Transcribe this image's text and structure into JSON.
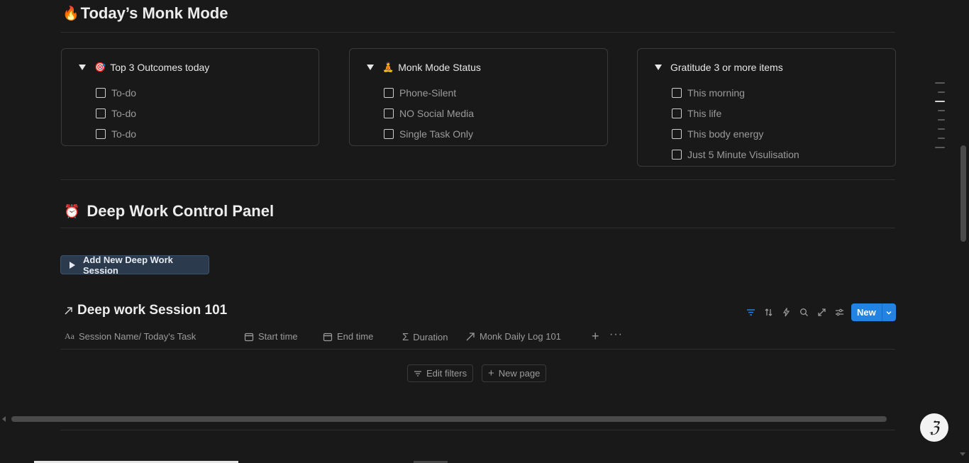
{
  "monk_mode": {
    "emoji": "🔥",
    "title": "Today’s Monk Mode"
  },
  "cards": [
    {
      "emoji": "🎯",
      "title": "Top 3 Outcomes today",
      "items": [
        "To-do",
        "To-do",
        "To-do"
      ]
    },
    {
      "emoji": "🧘",
      "title": "Monk Mode Status",
      "items": [
        "Phone-Silent",
        "NO Social Media",
        "Single Task Only"
      ]
    },
    {
      "emoji": "",
      "title": "Gratitude 3 or more items",
      "items": [
        "This morning",
        "This life",
        "This body energy",
        "Just 5 Minute Visulisation"
      ]
    }
  ],
  "deep_work": {
    "emoji": "⏰",
    "title": "Deep Work Control Panel",
    "add_button_label": "Add New Deep Work Session"
  },
  "database": {
    "title": "Deep work Session 101",
    "new_button_label": "New",
    "columns": [
      {
        "label": "Session Name/ Today's Task",
        "icon": "text-icon"
      },
      {
        "label": "Start time",
        "icon": "calendar-icon"
      },
      {
        "label": "End time",
        "icon": "calendar-icon"
      },
      {
        "label": "Duration",
        "icon": "sigma-icon"
      },
      {
        "label": "Monk Daily Log 101",
        "icon": "relation-arrow-icon"
      }
    ],
    "edit_filters_label": "Edit filters",
    "new_page_label": "New page"
  },
  "colors": {
    "accent": "#2383e2",
    "background": "#191919",
    "button_bg": "#2b3a4d"
  }
}
